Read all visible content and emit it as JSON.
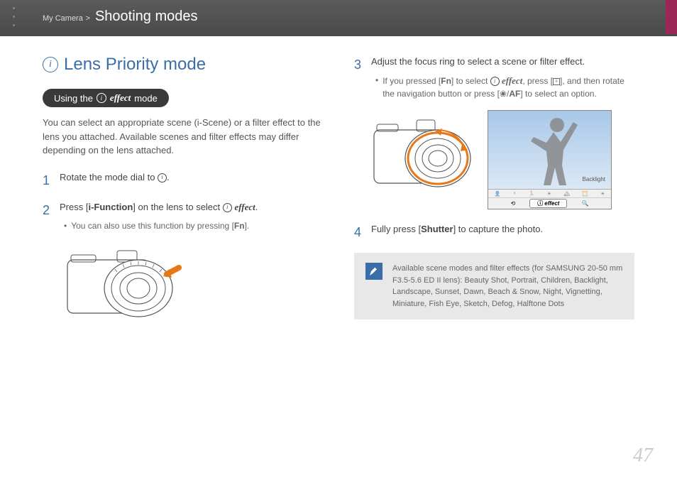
{
  "breadcrumb_parent": "My Camera",
  "breadcrumb_current": "Shooting modes",
  "heading": "Lens Priority mode",
  "pill_using": "Using the",
  "pill_effect": "effect",
  "pill_mode": "mode",
  "intro": "You can select an appropriate scene (i-Scene) or a filter effect to the lens you attached. Available scenes and filter effects may differ depending on the lens attached.",
  "step1": "Rotate the mode dial to ",
  "step2_a": "Press [",
  "step2_b": "i-Function",
  "step2_c": "] on the lens to select ",
  "step2_effect": "effect",
  "step2_bullet": "You can also use this function by pressing [",
  "step2_fn": "Fn",
  "step3": "Adjust the focus ring to select a scene or filter effect.",
  "step3_bullet_a": "If you pressed [",
  "step3_fn": "Fn",
  "step3_bullet_b": "] to select ",
  "step3_effect": "effect",
  "step3_bullet_c": ", press [",
  "step3_bullet_d": "], and then rotate the navigation button or press [",
  "step3_bullet_e": "] to select an option.",
  "backlight": "Backlight",
  "effect_btn": "effect",
  "step4_a": "Fully press [",
  "step4_b": "Shutter",
  "step4_c": "] to capture the photo.",
  "note": "Available scene modes and filter effects (for SAMSUNG 20-50 mm F3.5-5.6 ED II lens): Beauty Shot, Portrait, Children, Backlight, Landscape, Sunset, Dawn, Beach & Snow, Night, Vignetting, Miniature, Fish Eye, Sketch, Defog, Halftone Dots",
  "page": "47"
}
